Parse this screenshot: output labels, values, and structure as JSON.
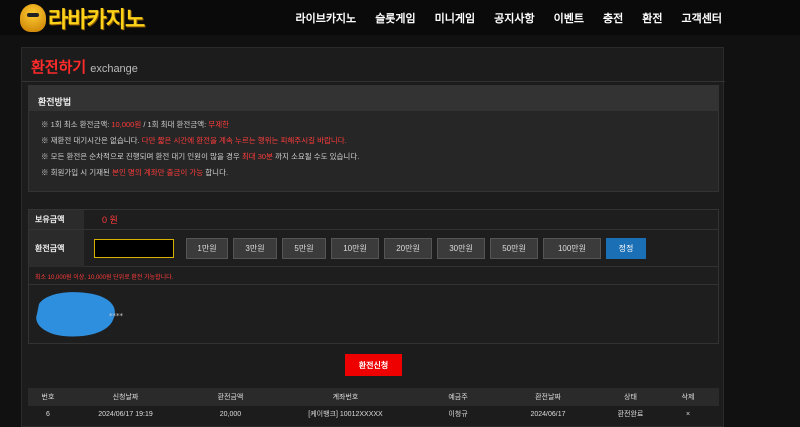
{
  "brand": {
    "logo_text": "라바카지노"
  },
  "nav": [
    "라이브카지노",
    "슬롯게임",
    "미니게임",
    "공지사항",
    "이벤트",
    "충전",
    "환전",
    "고객센터"
  ],
  "page": {
    "title": "환전하기",
    "subtitle": "exchange"
  },
  "method": {
    "heading": "환전방법",
    "lines": [
      {
        "parts": [
          {
            "t": "※ 1회 최소 환전금액: ",
            "r": false
          },
          {
            "t": "10,000원",
            "r": true
          },
          {
            "t": " / 1회 최대 환전금액: ",
            "r": false
          },
          {
            "t": "무제한",
            "r": true
          }
        ]
      },
      {
        "parts": [
          {
            "t": "※ 재환전 대기시간은 없습니다. ",
            "r": false
          },
          {
            "t": "다만 짧은 시간에 환전을 계속 누르는 행위는 피해주시길 바랍니다.",
            "r": true
          }
        ]
      },
      {
        "parts": [
          {
            "t": "※ 모든 환전은 순차적으로 진행되며 환전 대기 인원이 많을 경우 ",
            "r": false
          },
          {
            "t": "최대 30분",
            "r": true
          },
          {
            "t": " 까지 소요될 수도 있습니다.",
            "r": false
          }
        ]
      },
      {
        "parts": [
          {
            "t": "※ 회원가입 시 기재된 ",
            "r": false
          },
          {
            "t": "본인 명의 계좌만 출금이 가능",
            "r": true
          },
          {
            "t": " 합니다.",
            "r": false
          }
        ]
      }
    ]
  },
  "form": {
    "balance_label": "보유금액",
    "balance_value": "0 원",
    "amount_label": "환전금액",
    "amount_value": "",
    "amount_buttons": [
      "1만원",
      "3만원",
      "5만원",
      "10만원",
      "20만원",
      "30만원",
      "50만원",
      "100만원"
    ],
    "reset_label": "정정",
    "note": "최소 10,000원 이상, 10,000원 단위로 환전 가능합니다.",
    "masked_text": "****"
  },
  "submit_label": "환전신청",
  "table": {
    "headers": [
      "번호",
      "신청날짜",
      "환전금액",
      "계좌번호",
      "예금주",
      "환전날짜",
      "상태",
      "삭제"
    ],
    "rows": [
      [
        "6",
        "2024/06/17 19:19",
        "20,000",
        "[케이뱅크] 10012XXXXX",
        "이청규",
        "2024/06/17",
        "환전완료",
        "×"
      ]
    ]
  },
  "colors": {
    "accent_red": "#ff2b2b",
    "reset_blue": "#1b6fb5",
    "submit_red": "#ee0000"
  }
}
